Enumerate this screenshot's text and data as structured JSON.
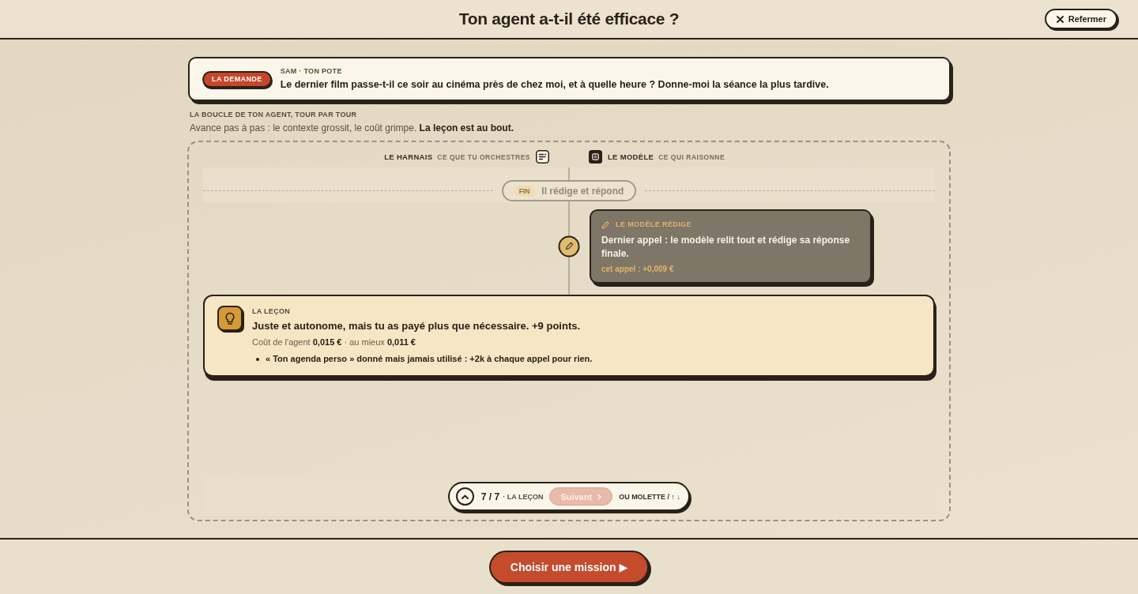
{
  "header": {
    "title": "Ton agent a-t-il été efficace ?",
    "close_label": "Refermer"
  },
  "request": {
    "tag": "LA DEMANDE",
    "sender": "SAM · TON POTE",
    "message": "Le dernier film passe-t-il ce soir au cinéma près de chez moi, et à quelle heure ? Donne-moi la séance la plus tardive."
  },
  "loop": {
    "heading": "LA BOUCLE DE TON AGENT, TOUR PAR TOUR",
    "intro": "Avance pas à pas : le contexte grossit, le coût grimpe. **La leçon est au bout.**"
  },
  "lanes": [
    {
      "kind": "harness",
      "title": "LE HARNAIS",
      "subtitle": "CE QUE TU ORCHESTRES"
    },
    {
      "kind": "model",
      "title": "LE MODÈLE",
      "subtitle": "CE QUI RAISONNE"
    }
  ],
  "phase_marker": {
    "tag": "FIN",
    "label": "Il rédige et répond",
    "dimmed": true
  },
  "steps": [
    {
      "kind": "model",
      "title": "LE MODÈLE RÉDIGE",
      "text": "Dernier appel : le modèle relit tout et rédige sa réponse finale.",
      "cost": "cet appel : +0,009 €"
    }
  ],
  "lesson": {
    "heading": "LA LEÇON",
    "verdict": "Juste et autonome, mais tu as payé plus que nécessaire. +9 points.",
    "cost_line": "Coût de l'agent **0,015 €** · au mieux **0,011 €**",
    "notes": [
      "« Ton agenda perso » donné mais jamais utilisé : +2k à chaque appel pour rien."
    ]
  },
  "stepper": {
    "counter": "7 / 7",
    "label": "· LA LEÇON",
    "next_label": "Suivant",
    "next_disabled": true,
    "hint": "OU MOLETTE / ↑ ↓"
  },
  "footer": {
    "cta": "Choisir une mission ▶"
  }
}
